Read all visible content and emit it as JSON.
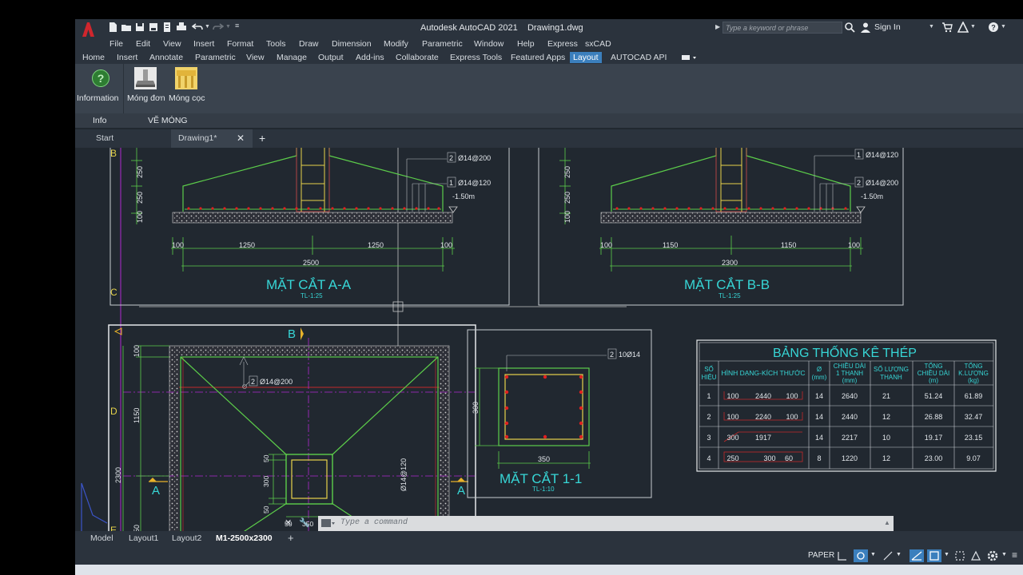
{
  "app": {
    "title": "Autodesk AutoCAD 2021",
    "document": "Drawing1.dwg",
    "logo_letter": "A",
    "accent": "#3b7fbd",
    "logo_color": "#d0262d"
  },
  "titlebar": {
    "search_placeholder": "Type a keyword or phrase",
    "sign_in": "Sign In"
  },
  "menubar": {
    "items": [
      "File",
      "Edit",
      "View",
      "Insert",
      "Format",
      "Tools",
      "Draw",
      "Dimension",
      "Modify",
      "Parametric",
      "Window",
      "Help",
      "Express",
      "sxCAD"
    ]
  },
  "ribbon_tabs": {
    "items": [
      "Home",
      "Insert",
      "Annotate",
      "Parametric",
      "View",
      "Manage",
      "Output",
      "Add-ins",
      "Collaborate",
      "Express Tools",
      "Featured Apps",
      "Layout",
      "AUTOCAD API"
    ],
    "active": "Layout"
  },
  "ribbon": {
    "info_button": "Information",
    "mong_don": "Móng đơn",
    "mong_coc": "Móng cọc",
    "panel_info": "Info",
    "panel_ve_mong": "VẼ MÓNG"
  },
  "file_tabs": {
    "start": "Start",
    "drawing": "Drawing1*"
  },
  "drawing": {
    "grid": {
      "b": "B",
      "c": "C",
      "d": "D",
      "e": "E"
    },
    "section_aa": {
      "title": "MẶT CẮT A-A",
      "scale": "TL-1:25",
      "rebar_top": "2",
      "rebar_top_text": "Ø14@200",
      "rebar_bot": "1",
      "rebar_bot_text": "Ø14@120",
      "level": "-1.50m",
      "dims": [
        "100",
        "1250",
        "1250",
        "100",
        "2500"
      ],
      "vdims": [
        "250",
        "250",
        "100"
      ]
    },
    "section_bb": {
      "title": "MẶT CẮT B-B",
      "scale": "TL-1:25",
      "rebar_top": "1",
      "rebar_top_text": "Ø14@120",
      "rebar_bot": "2",
      "rebar_bot_text": "Ø14@200",
      "level": "-1.50m",
      "dims": [
        "100",
        "1150",
        "1150",
        "100",
        "2300"
      ],
      "vdims": [
        "250",
        "250",
        "100"
      ]
    },
    "plan": {
      "marker_b": "B",
      "marker_a_left": "A",
      "marker_a_right": "A",
      "rebar_label": "2",
      "rebar_text": "Ø14@200",
      "rebar_vertical": "Ø14@120",
      "vdims": [
        "100",
        "1150",
        "2300",
        "50"
      ],
      "col_dims": [
        "50",
        "300",
        "50"
      ],
      "col_hdims": [
        "50",
        "350",
        "50"
      ]
    },
    "section_11": {
      "title": "MẶT CẮT 1-1",
      "scale": "TL-1:10",
      "rebar_label": "2",
      "rebar_text": "10Ø14",
      "dim_w": "350",
      "dim_h": "300"
    },
    "table": {
      "title": "BẢNG THỐNG KÊ THÉP",
      "headers": [
        "SỐ HIỆU",
        "HÌNH DẠNG-KÍCH THƯỚC",
        "Ø (mm)",
        "CHIỀU DÀI 1 THANH (mm)",
        "SỐ LƯỢNG THANH",
        "TỔNG CHIỀU DÀI (m)",
        "TỔNG K.LƯỢNG (kg)"
      ],
      "rows": [
        {
          "no": "1",
          "shape": [
            "100",
            "2440",
            "100"
          ],
          "dia": "14",
          "len": "2640",
          "qty": "21",
          "total": "51.24",
          "mass": "61.89"
        },
        {
          "no": "2",
          "shape": [
            "100",
            "2240",
            "100"
          ],
          "dia": "14",
          "len": "2440",
          "qty": "12",
          "total": "26.88",
          "mass": "32.47"
        },
        {
          "no": "3",
          "shape": [
            "300",
            "1917",
            ""
          ],
          "dia": "14",
          "len": "2217",
          "qty": "10",
          "total": "19.17",
          "mass": "23.15"
        },
        {
          "no": "4",
          "shape": [
            "250",
            "300",
            "60"
          ],
          "dia": "8",
          "len": "1220",
          "qty": "12",
          "total": "23.00",
          "mass": "9.07"
        }
      ]
    }
  },
  "command": {
    "placeholder": "Type a command"
  },
  "layout_tabs": {
    "items": [
      "Model",
      "Layout1",
      "Layout2",
      "M1-2500x2300"
    ],
    "active": "M1-2500x2300"
  },
  "status": {
    "paper": "PAPER"
  }
}
